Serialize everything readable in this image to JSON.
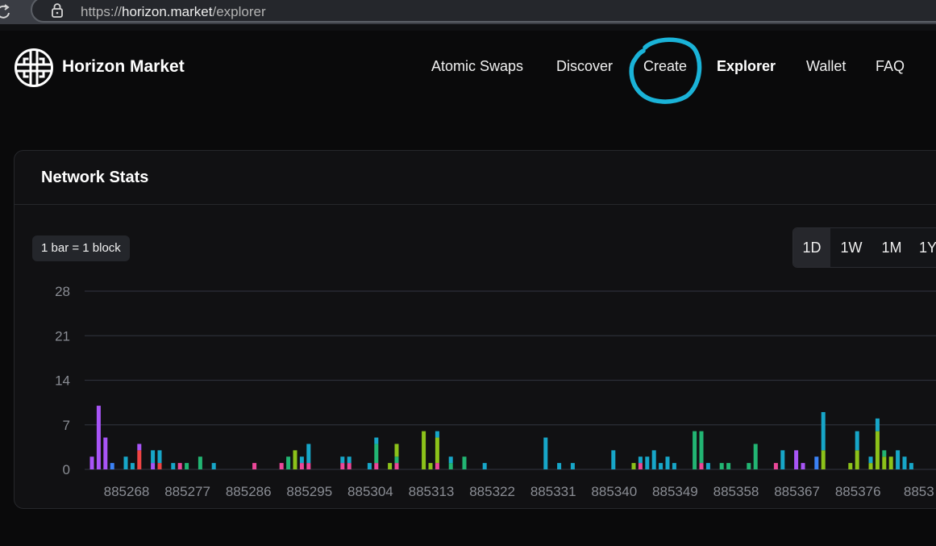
{
  "browser": {
    "url_scheme": "https://",
    "url_host": "horizon.market",
    "url_path": "/explorer"
  },
  "brand": {
    "name": "Horizon Market"
  },
  "nav": {
    "items": [
      {
        "label": "Atomic Swaps",
        "active": false
      },
      {
        "label": "Discover",
        "active": false
      },
      {
        "label": "Create",
        "active": false,
        "annotated": true
      },
      {
        "label": "Explorer",
        "active": true
      },
      {
        "label": "Wallet",
        "active": false
      },
      {
        "label": "FAQ",
        "active": false
      }
    ]
  },
  "annotation": {
    "color": "#1ab3d8",
    "target": "Create"
  },
  "stats": {
    "title": "Network Stats",
    "bar_note": "1 bar = 1 block",
    "ranges": [
      "1D",
      "1W",
      "1M",
      "1Y"
    ],
    "selected_range": "1D"
  },
  "colors": {
    "background": "#0a0a0b",
    "card": "#111113",
    "gridline": "#2c2f38",
    "axis_text": "#8a8d94",
    "purple": "#a855f7",
    "blue": "#3b82f6",
    "cyan": "#17a6c8",
    "red": "#ef4444",
    "pink": "#ec4899",
    "green": "#22b573",
    "lime": "#8cc21a"
  },
  "chart_data": {
    "type": "bar",
    "stacked": true,
    "ylim": [
      0,
      28
    ],
    "yticks": [
      0,
      7,
      14,
      21,
      28
    ],
    "xtick_labels": [
      "885268",
      "885277",
      "885286",
      "885295",
      "885304",
      "885313",
      "885322",
      "885331",
      "885340",
      "885349",
      "885358",
      "885367",
      "885376",
      "8853"
    ],
    "x_start_block": 885263,
    "grid": true,
    "blocks": [
      {
        "block": 885263,
        "segments": [
          {
            "color": "purple",
            "value": 2
          }
        ]
      },
      {
        "block": 885264,
        "segments": [
          {
            "color": "purple",
            "value": 10
          }
        ]
      },
      {
        "block": 885265,
        "segments": [
          {
            "color": "purple",
            "value": 5
          }
        ]
      },
      {
        "block": 885266,
        "segments": [
          {
            "color": "blue",
            "value": 1
          }
        ]
      },
      {
        "block": 885267,
        "segments": []
      },
      {
        "block": 885268,
        "segments": [
          {
            "color": "cyan",
            "value": 2
          }
        ]
      },
      {
        "block": 885269,
        "segments": [
          {
            "color": "cyan",
            "value": 1
          }
        ]
      },
      {
        "block": 885270,
        "segments": [
          {
            "color": "red",
            "value": 3
          },
          {
            "color": "purple",
            "value": 1
          }
        ]
      },
      {
        "block": 885271,
        "segments": []
      },
      {
        "block": 885272,
        "segments": [
          {
            "color": "purple",
            "value": 1
          },
          {
            "color": "cyan",
            "value": 2
          }
        ]
      },
      {
        "block": 885273,
        "segments": [
          {
            "color": "red",
            "value": 1
          },
          {
            "color": "cyan",
            "value": 2
          }
        ]
      },
      {
        "block": 885274,
        "segments": []
      },
      {
        "block": 885275,
        "segments": [
          {
            "color": "cyan",
            "value": 1
          }
        ]
      },
      {
        "block": 885276,
        "segments": [
          {
            "color": "pink",
            "value": 1
          }
        ]
      },
      {
        "block": 885277,
        "segments": [
          {
            "color": "green",
            "value": 1
          }
        ]
      },
      {
        "block": 885278,
        "segments": []
      },
      {
        "block": 885279,
        "segments": [
          {
            "color": "green",
            "value": 2
          }
        ]
      },
      {
        "block": 885280,
        "segments": []
      },
      {
        "block": 885281,
        "segments": [
          {
            "color": "cyan",
            "value": 1
          }
        ]
      },
      {
        "block": 885282,
        "segments": []
      },
      {
        "block": 885283,
        "segments": []
      },
      {
        "block": 885284,
        "segments": []
      },
      {
        "block": 885285,
        "segments": []
      },
      {
        "block": 885286,
        "segments": []
      },
      {
        "block": 885287,
        "segments": [
          {
            "color": "pink",
            "value": 1
          }
        ]
      },
      {
        "block": 885288,
        "segments": []
      },
      {
        "block": 885289,
        "segments": []
      },
      {
        "block": 885290,
        "segments": []
      },
      {
        "block": 885291,
        "segments": [
          {
            "color": "pink",
            "value": 1
          }
        ]
      },
      {
        "block": 885292,
        "segments": [
          {
            "color": "green",
            "value": 2
          }
        ]
      },
      {
        "block": 885293,
        "segments": [
          {
            "color": "lime",
            "value": 3
          }
        ]
      },
      {
        "block": 885294,
        "segments": [
          {
            "color": "pink",
            "value": 1
          },
          {
            "color": "cyan",
            "value": 1
          }
        ]
      },
      {
        "block": 885295,
        "segments": [
          {
            "color": "pink",
            "value": 1
          },
          {
            "color": "cyan",
            "value": 3
          }
        ]
      },
      {
        "block": 885296,
        "segments": []
      },
      {
        "block": 885297,
        "segments": []
      },
      {
        "block": 885298,
        "segments": []
      },
      {
        "block": 885299,
        "segments": []
      },
      {
        "block": 885300,
        "segments": [
          {
            "color": "pink",
            "value": 1
          },
          {
            "color": "cyan",
            "value": 1
          }
        ]
      },
      {
        "block": 885301,
        "segments": [
          {
            "color": "pink",
            "value": 1
          },
          {
            "color": "cyan",
            "value": 1
          }
        ]
      },
      {
        "block": 885302,
        "segments": []
      },
      {
        "block": 885303,
        "segments": []
      },
      {
        "block": 885304,
        "segments": [
          {
            "color": "cyan",
            "value": 1
          }
        ]
      },
      {
        "block": 885305,
        "segments": [
          {
            "color": "pink",
            "value": 1
          },
          {
            "color": "green",
            "value": 3
          },
          {
            "color": "cyan",
            "value": 1
          }
        ]
      },
      {
        "block": 885306,
        "segments": []
      },
      {
        "block": 885307,
        "segments": [
          {
            "color": "lime",
            "value": 1
          }
        ]
      },
      {
        "block": 885308,
        "segments": [
          {
            "color": "pink",
            "value": 1
          },
          {
            "color": "green",
            "value": 1
          },
          {
            "color": "lime",
            "value": 2
          }
        ]
      },
      {
        "block": 885309,
        "segments": []
      },
      {
        "block": 885310,
        "segments": []
      },
      {
        "block": 885311,
        "segments": []
      },
      {
        "block": 885312,
        "segments": [
          {
            "color": "lime",
            "value": 6
          }
        ]
      },
      {
        "block": 885313,
        "segments": [
          {
            "color": "lime",
            "value": 1
          }
        ]
      },
      {
        "block": 885314,
        "segments": [
          {
            "color": "pink",
            "value": 1
          },
          {
            "color": "lime",
            "value": 4
          },
          {
            "color": "cyan",
            "value": 1
          }
        ]
      },
      {
        "block": 885315,
        "segments": []
      },
      {
        "block": 885316,
        "segments": [
          {
            "color": "green",
            "value": 1
          },
          {
            "color": "cyan",
            "value": 1
          }
        ]
      },
      {
        "block": 885317,
        "segments": []
      },
      {
        "block": 885318,
        "segments": [
          {
            "color": "green",
            "value": 2
          }
        ]
      },
      {
        "block": 885319,
        "segments": []
      },
      {
        "block": 885320,
        "segments": []
      },
      {
        "block": 885321,
        "segments": [
          {
            "color": "cyan",
            "value": 1
          }
        ]
      },
      {
        "block": 885322,
        "segments": []
      },
      {
        "block": 885323,
        "segments": []
      },
      {
        "block": 885324,
        "segments": []
      },
      {
        "block": 885325,
        "segments": []
      },
      {
        "block": 885326,
        "segments": []
      },
      {
        "block": 885327,
        "segments": []
      },
      {
        "block": 885328,
        "segments": []
      },
      {
        "block": 885329,
        "segments": []
      },
      {
        "block": 885330,
        "segments": [
          {
            "color": "cyan",
            "value": 5
          }
        ]
      },
      {
        "block": 885331,
        "segments": []
      },
      {
        "block": 885332,
        "segments": [
          {
            "color": "cyan",
            "value": 1
          }
        ]
      },
      {
        "block": 885333,
        "segments": []
      },
      {
        "block": 885334,
        "segments": [
          {
            "color": "cyan",
            "value": 1
          }
        ]
      },
      {
        "block": 885335,
        "segments": []
      },
      {
        "block": 885336,
        "segments": []
      },
      {
        "block": 885337,
        "segments": []
      },
      {
        "block": 885338,
        "segments": []
      },
      {
        "block": 885339,
        "segments": []
      },
      {
        "block": 885340,
        "segments": [
          {
            "color": "cyan",
            "value": 3
          }
        ]
      },
      {
        "block": 885341,
        "segments": []
      },
      {
        "block": 885342,
        "segments": []
      },
      {
        "block": 885343,
        "segments": [
          {
            "color": "lime",
            "value": 1
          }
        ]
      },
      {
        "block": 885344,
        "segments": [
          {
            "color": "pink",
            "value": 1
          },
          {
            "color": "cyan",
            "value": 1
          }
        ]
      },
      {
        "block": 885345,
        "segments": [
          {
            "color": "cyan",
            "value": 2
          }
        ]
      },
      {
        "block": 885346,
        "segments": [
          {
            "color": "cyan",
            "value": 3
          }
        ]
      },
      {
        "block": 885347,
        "segments": [
          {
            "color": "cyan",
            "value": 1
          }
        ]
      },
      {
        "block": 885348,
        "segments": [
          {
            "color": "cyan",
            "value": 2
          }
        ]
      },
      {
        "block": 885349,
        "segments": [
          {
            "color": "cyan",
            "value": 1
          }
        ]
      },
      {
        "block": 885350,
        "segments": []
      },
      {
        "block": 885351,
        "segments": []
      },
      {
        "block": 885352,
        "segments": [
          {
            "color": "green",
            "value": 6
          }
        ]
      },
      {
        "block": 885353,
        "segments": [
          {
            "color": "pink",
            "value": 1
          },
          {
            "color": "green",
            "value": 5
          }
        ]
      },
      {
        "block": 885354,
        "segments": [
          {
            "color": "cyan",
            "value": 1
          }
        ]
      },
      {
        "block": 885355,
        "segments": []
      },
      {
        "block": 885356,
        "segments": [
          {
            "color": "green",
            "value": 1
          }
        ]
      },
      {
        "block": 885357,
        "segments": [
          {
            "color": "green",
            "value": 1
          }
        ]
      },
      {
        "block": 885358,
        "segments": []
      },
      {
        "block": 885359,
        "segments": []
      },
      {
        "block": 885360,
        "segments": [
          {
            "color": "green",
            "value": 1
          }
        ]
      },
      {
        "block": 885361,
        "segments": [
          {
            "color": "green",
            "value": 4
          }
        ]
      },
      {
        "block": 885362,
        "segments": []
      },
      {
        "block": 885363,
        "segments": []
      },
      {
        "block": 885364,
        "segments": [
          {
            "color": "pink",
            "value": 1
          }
        ]
      },
      {
        "block": 885365,
        "segments": [
          {
            "color": "cyan",
            "value": 3
          }
        ]
      },
      {
        "block": 885366,
        "segments": []
      },
      {
        "block": 885367,
        "segments": [
          {
            "color": "purple",
            "value": 3
          }
        ]
      },
      {
        "block": 885368,
        "segments": [
          {
            "color": "purple",
            "value": 1
          }
        ]
      },
      {
        "block": 885369,
        "segments": []
      },
      {
        "block": 885370,
        "segments": [
          {
            "color": "blue",
            "value": 2
          }
        ]
      },
      {
        "block": 885371,
        "segments": [
          {
            "color": "lime",
            "value": 3
          },
          {
            "color": "cyan",
            "value": 6
          }
        ]
      },
      {
        "block": 885372,
        "segments": []
      },
      {
        "block": 885373,
        "segments": []
      },
      {
        "block": 885374,
        "segments": []
      },
      {
        "block": 885375,
        "segments": [
          {
            "color": "lime",
            "value": 1
          }
        ]
      },
      {
        "block": 885376,
        "segments": [
          {
            "color": "lime",
            "value": 3
          },
          {
            "color": "cyan",
            "value": 3
          }
        ]
      },
      {
        "block": 885377,
        "segments": []
      },
      {
        "block": 885378,
        "segments": [
          {
            "color": "lime",
            "value": 1
          },
          {
            "color": "cyan",
            "value": 1
          }
        ]
      },
      {
        "block": 885379,
        "segments": [
          {
            "color": "lime",
            "value": 6
          },
          {
            "color": "cyan",
            "value": 2
          }
        ]
      },
      {
        "block": 885380,
        "segments": [
          {
            "color": "lime",
            "value": 2
          },
          {
            "color": "green",
            "value": 1
          }
        ]
      },
      {
        "block": 885381,
        "segments": [
          {
            "color": "lime",
            "value": 2
          }
        ]
      },
      {
        "block": 885382,
        "segments": [
          {
            "color": "cyan",
            "value": 3
          }
        ]
      },
      {
        "block": 885383,
        "segments": [
          {
            "color": "cyan",
            "value": 2
          }
        ]
      },
      {
        "block": 885384,
        "segments": [
          {
            "color": "cyan",
            "value": 1
          }
        ]
      }
    ]
  }
}
